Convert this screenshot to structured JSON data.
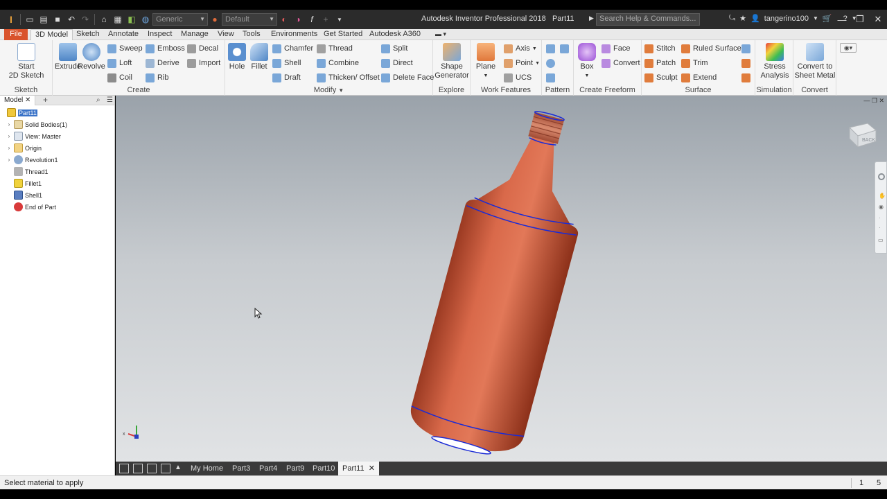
{
  "app": {
    "title": "Autodesk Inventor Professional 2018",
    "document": "Part11",
    "search_placeholder": "Search Help & Commands...",
    "username": "tangerino100",
    "material_combo": "Generic",
    "appearance_combo": "Default"
  },
  "menu_tabs": [
    "File",
    "3D Model",
    "Sketch",
    "Annotate",
    "Inspect",
    "Manage",
    "View",
    "Tools",
    "Environments",
    "Get Started",
    "Autodesk A360"
  ],
  "active_tab": "3D Model",
  "ribbon": {
    "sketch": {
      "title": "Sketch",
      "start_line1": "Start",
      "start_line2": "2D Sketch"
    },
    "create": {
      "title": "Create",
      "extrude": "Extrude",
      "revolve": "Revolve",
      "sweep": "Sweep",
      "loft": "Loft",
      "coil": "Coil",
      "emboss": "Emboss",
      "derive": "Derive",
      "rib": "Rib",
      "decal": "Decal",
      "import": "Import"
    },
    "modify": {
      "title": "Modify",
      "hole": "Hole",
      "fillet": "Fillet",
      "chamfer": "Chamfer",
      "shell": "Shell",
      "draft": "Draft",
      "thread": "Thread",
      "combine": "Combine",
      "thicken": "Thicken/ Offset",
      "split": "Split",
      "direct": "Direct",
      "delete_face": "Delete Face"
    },
    "explore": {
      "title": "Explore",
      "shape_line1": "Shape",
      "shape_line2": "Generator"
    },
    "work_features": {
      "title": "Work Features",
      "plane": "Plane",
      "axis": "Axis",
      "point": "Point",
      "ucs": "UCS"
    },
    "pattern": {
      "title": "Pattern"
    },
    "freeform": {
      "title": "Create Freeform",
      "box": "Box",
      "face": "Face",
      "convert": "Convert"
    },
    "surface": {
      "title": "Surface",
      "stitch": "Stitch",
      "patch": "Patch",
      "sculpt": "Sculpt",
      "ruled": "Ruled Surface",
      "trim": "Trim",
      "extend": "Extend"
    },
    "simulation": {
      "title": "Simulation",
      "stress_line1": "Stress",
      "stress_line2": "Analysis"
    },
    "convert": {
      "title": "Convert",
      "sheet_line1": "Convert to",
      "sheet_line2": "Sheet Metal"
    }
  },
  "browser": {
    "tab_label": "Model",
    "tree": [
      {
        "label": "Part11",
        "icon": "part-icon",
        "selected": true,
        "expandable": false
      },
      {
        "label": "Solid Bodies(1)",
        "icon": "solid-bodies-icon",
        "selected": false,
        "expandable": true
      },
      {
        "label": "View: Master",
        "icon": "view-icon",
        "selected": false,
        "expandable": true
      },
      {
        "label": "Origin",
        "icon": "folder-icon",
        "selected": false,
        "expandable": true
      },
      {
        "label": "Revolution1",
        "icon": "revolve-feature-icon",
        "selected": false,
        "expandable": true
      },
      {
        "label": "Thread1",
        "icon": "thread-feature-icon",
        "selected": false,
        "expandable": false
      },
      {
        "label": "Fillet1",
        "icon": "fillet-feature-icon",
        "selected": false,
        "expandable": false
      },
      {
        "label": "Shell1",
        "icon": "shell-feature-icon",
        "selected": false,
        "expandable": false
      },
      {
        "label": "End of Part",
        "icon": "end-of-part-icon",
        "selected": false,
        "expandable": false
      }
    ]
  },
  "viewcube_label": "BACK",
  "doc_tabs": [
    "My Home",
    "Part3",
    "Part4",
    "Part9",
    "Part10",
    "Part11"
  ],
  "active_doc": "Part11",
  "status": {
    "message": "Select material to apply",
    "count1": "1",
    "count2": "5"
  },
  "colors": {
    "file_tab": "#d9532c",
    "bottle": "#c9583a",
    "edge_highlight": "#1a2bd6",
    "selection": "#3a73c8"
  }
}
